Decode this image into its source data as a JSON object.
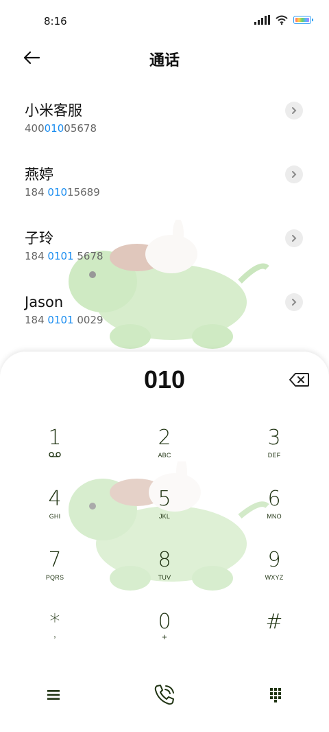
{
  "status": {
    "time": "8:16"
  },
  "header": {
    "title": "通话"
  },
  "results": [
    {
      "name": "小米客服",
      "number_pre": "400",
      "number_hl": "010",
      "number_post": "05678"
    },
    {
      "name": "燕婷",
      "number_pre": "184 ",
      "number_hl": "010",
      "number_post": "15689"
    },
    {
      "name": "子玲",
      "number_pre": "184 ",
      "number_hl": "0101",
      "number_post": " 5678"
    },
    {
      "name": "Jason",
      "number_pre": "184 ",
      "number_hl": "0101",
      "number_post": " 0029"
    }
  ],
  "dialer": {
    "input": "010",
    "keys": [
      {
        "digit": "1",
        "letters": ""
      },
      {
        "digit": "2",
        "letters": "ABC"
      },
      {
        "digit": "3",
        "letters": "DEF"
      },
      {
        "digit": "4",
        "letters": "GHI"
      },
      {
        "digit": "5",
        "letters": "JKL"
      },
      {
        "digit": "6",
        "letters": "MNO"
      },
      {
        "digit": "7",
        "letters": "PQRS"
      },
      {
        "digit": "8",
        "letters": "TUV"
      },
      {
        "digit": "9",
        "letters": "WXYZ"
      },
      {
        "digit": "*",
        "letters": ","
      },
      {
        "digit": "0",
        "letters": "+"
      },
      {
        "digit": "#",
        "letters": ""
      }
    ]
  },
  "colors": {
    "accent": "#1a8df0",
    "keypad_text": "#1f3312",
    "battery": "#2a9df4"
  },
  "icons": {
    "back": "arrow-left-icon",
    "chevron": "chevron-right-icon",
    "backspace": "backspace-icon",
    "voicemail": "voicemail-icon",
    "menu": "menu-icon",
    "call": "phone-call-icon",
    "dialpad": "dialpad-icon"
  }
}
